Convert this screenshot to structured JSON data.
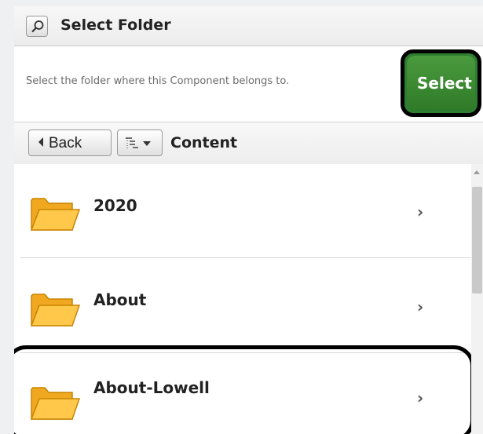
{
  "dialog": {
    "title": "Select Folder",
    "search_icon": "search-icon"
  },
  "instruction": {
    "text": "Select the folder where this Component belongs to.",
    "select_label": "Select",
    "select_color": "#3a8a34"
  },
  "toolbar": {
    "back_label": "Back",
    "view_icon": "tree-view-icon",
    "breadcrumb": "Content"
  },
  "folders": [
    {
      "name": "2020",
      "icon": "folder-icon"
    },
    {
      "name": "About",
      "icon": "folder-icon"
    },
    {
      "name": "About-Lowell",
      "icon": "folder-icon"
    }
  ],
  "chevron": "›",
  "colors": {
    "folder": "#f5b630",
    "highlight": "#000000"
  }
}
